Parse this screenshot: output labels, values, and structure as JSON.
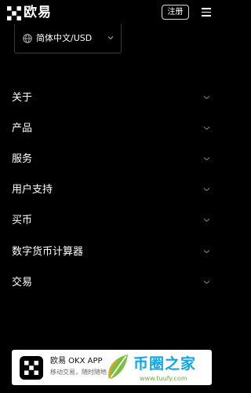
{
  "header": {
    "brand": "欧易",
    "signup_label": "注册"
  },
  "language": {
    "label": "简体中文/USD"
  },
  "menu": {
    "items": [
      {
        "label": "关于"
      },
      {
        "label": "产品"
      },
      {
        "label": "服务"
      },
      {
        "label": "用户支持"
      },
      {
        "label": "买币"
      },
      {
        "label": "数字货币计算器"
      },
      {
        "label": "交易"
      }
    ]
  },
  "app_banner": {
    "title": "欧易 OKX APP",
    "subtitle": "移动交易，随时随地"
  },
  "watermark": {
    "name": "币圈之家",
    "url": "www.tuufy.com"
  },
  "colors": {
    "background": "#000000",
    "text": "#ffffff",
    "watermark_blue": "#0ea5e9",
    "watermark_green": "#6fa83a"
  }
}
